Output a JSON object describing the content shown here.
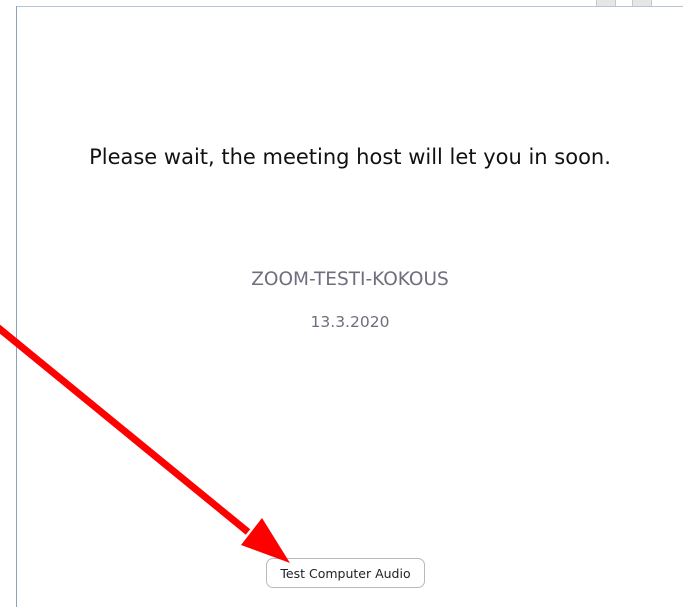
{
  "waiting_room": {
    "message": "Please wait, the meeting host will let you in soon.",
    "meeting_title": "ZOOM-TESTI-KOKOUS",
    "meeting_date": "13.3.2020",
    "test_audio_label": "Test Computer Audio"
  },
  "annotation": {
    "arrow_color": "#ff0000",
    "arrow_target": "test-audio-button"
  }
}
